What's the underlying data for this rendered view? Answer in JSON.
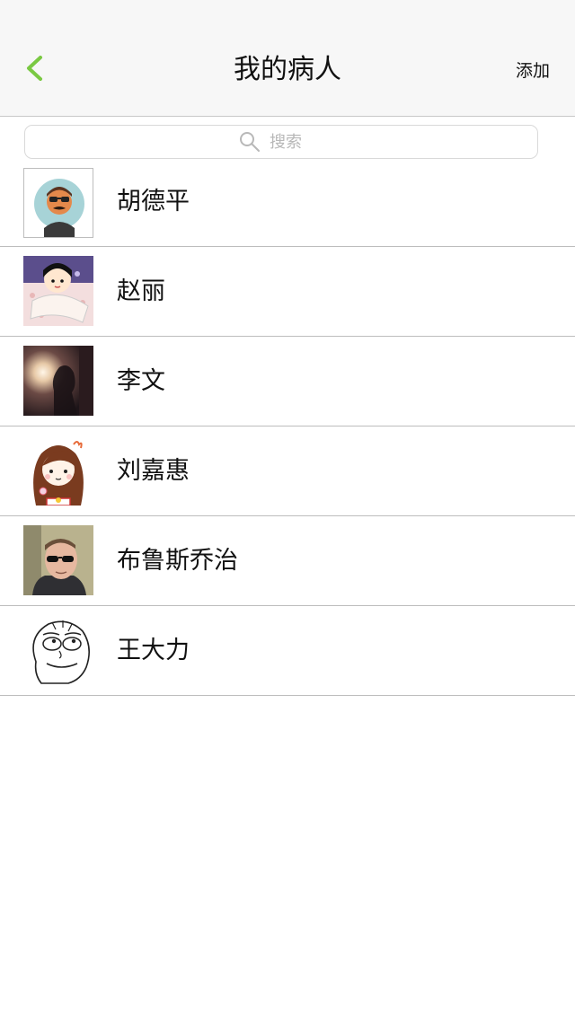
{
  "navbar": {
    "title": "我的病人",
    "add_label": "添加",
    "accent_color": "#7ac943"
  },
  "search": {
    "placeholder": "搜索"
  },
  "patients": [
    {
      "name": "胡德平",
      "avatar": "cartoon-man-sunglasses-mustache"
    },
    {
      "name": "赵丽",
      "avatar": "cartoon-girl-lying"
    },
    {
      "name": "李文",
      "avatar": "silhouette-sunset-photo"
    },
    {
      "name": "刘嘉惠",
      "avatar": "cartoon-girl-long-hair"
    },
    {
      "name": "布鲁斯乔治",
      "avatar": "man-with-sunglasses-photo"
    },
    {
      "name": "王大力",
      "avatar": "rage-face-sketch"
    }
  ]
}
